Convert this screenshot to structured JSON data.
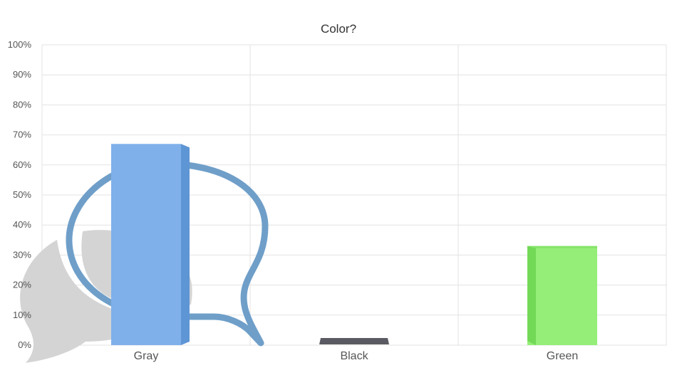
{
  "chart_data": {
    "type": "bar",
    "title": "Color?",
    "categories": [
      "Gray",
      "Black",
      "Green"
    ],
    "values": [
      67,
      0,
      33
    ],
    "colors": [
      "#7fb0ea",
      "#5a5a62",
      "#94ee77"
    ],
    "side_colors": [
      "#5e95d4",
      "#44444c",
      "#72d956"
    ],
    "top_colors": [
      "#6fa3e2",
      "#4e4e56",
      "#86e46a"
    ],
    "ylim": [
      0,
      100
    ],
    "yticks": [
      "0%",
      "10%",
      "20%",
      "30%",
      "40%",
      "50%",
      "60%",
      "70%",
      "80%",
      "90%",
      "100%"
    ],
    "xlabel": "",
    "ylabel": "",
    "grid": true
  },
  "watermark": {
    "icon": "speech-bubbles-logo-icon",
    "colors": {
      "bubble_fill": "#d4d4d4",
      "bubble_outline": "#6f9fc9"
    }
  }
}
